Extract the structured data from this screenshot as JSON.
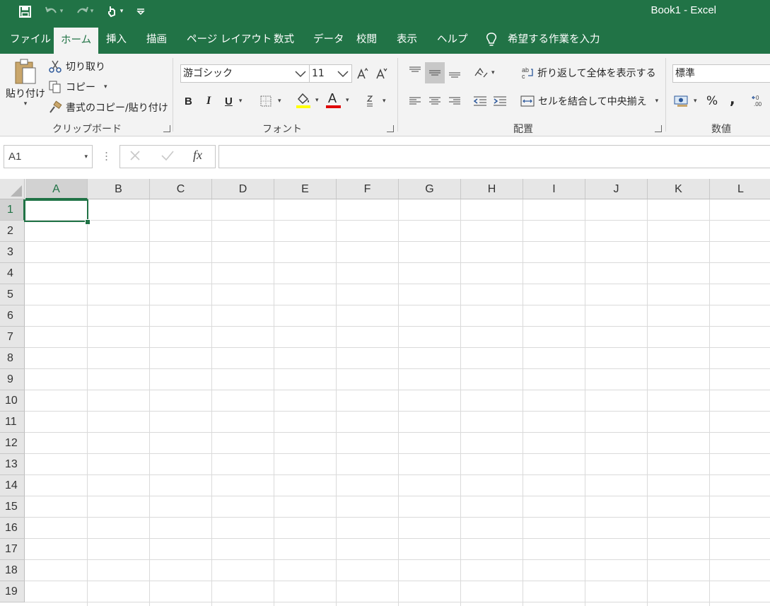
{
  "window": {
    "title": "Book1  -  Excel"
  },
  "tabs": [
    {
      "label": "ファイル"
    },
    {
      "label": "ホーム"
    },
    {
      "label": "挿入"
    },
    {
      "label": "描画"
    },
    {
      "label": "ページ レイアウト"
    },
    {
      "label": "数式"
    },
    {
      "label": "データ"
    },
    {
      "label": "校閲"
    },
    {
      "label": "表示"
    },
    {
      "label": "ヘルプ"
    }
  ],
  "tell_me": "希望する作業を入力",
  "clipboard": {
    "paste": "貼り付け",
    "cut": "切り取り",
    "copy": "コピー",
    "format_painter": "書式のコピー/貼り付け",
    "label": "クリップボード"
  },
  "font": {
    "name": "游ゴシック",
    "size": "11",
    "bold": "B",
    "italic": "I",
    "underline": "U",
    "font_color_glyph": "A",
    "label": "フォント",
    "highlight_color": "#ffff00",
    "font_color": "#e00000"
  },
  "alignment": {
    "wrap_text": "折り返して全体を表示する",
    "merge_center": "セルを結合して中央揃え",
    "label": "配置"
  },
  "number": {
    "format": "標準",
    "percent": "%",
    "comma": ",",
    "label": "数値"
  },
  "formula_bar": {
    "name_box": "A1",
    "fx": "fx",
    "content": ""
  },
  "columns": [
    "A",
    "B",
    "C",
    "D",
    "E",
    "F",
    "G",
    "H",
    "I",
    "J",
    "K",
    "L"
  ],
  "rows": [
    "1",
    "2",
    "3",
    "4",
    "5",
    "6",
    "7",
    "8",
    "9",
    "10",
    "11",
    "12",
    "13",
    "14",
    "15",
    "16",
    "17",
    "18",
    "19"
  ],
  "selected_cell": "A1",
  "colors": {
    "accent": "#217346"
  }
}
